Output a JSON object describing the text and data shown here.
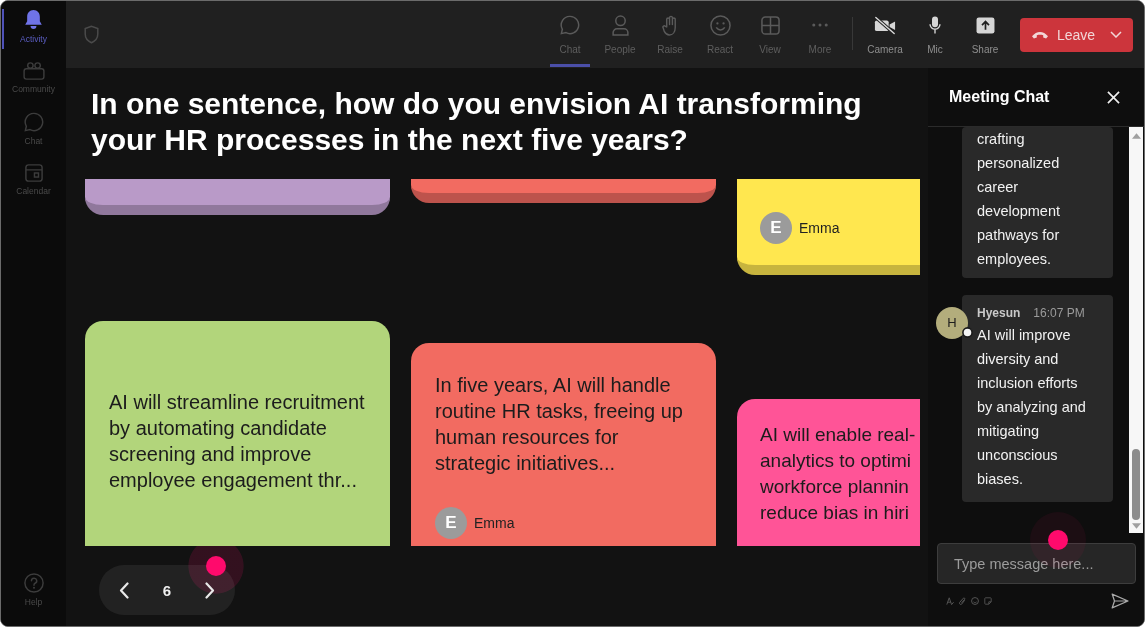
{
  "sidebar": {
    "items": [
      {
        "label": "Activity",
        "selected": true
      },
      {
        "label": "Community",
        "selected": false
      },
      {
        "label": "Chat",
        "selected": false
      },
      {
        "label": "Calendar",
        "selected": false
      }
    ],
    "help": {
      "label": "Help"
    }
  },
  "toolbar": {
    "view_controls": [
      {
        "label": "Chat",
        "selected": true
      },
      {
        "label": "People",
        "selected": false
      },
      {
        "label": "Raise",
        "selected": false
      },
      {
        "label": "React",
        "selected": false
      },
      {
        "label": "View",
        "selected": false
      },
      {
        "label": "More",
        "selected": false
      }
    ],
    "media_controls": [
      {
        "label": "Camera",
        "off": true
      },
      {
        "label": "Mic",
        "off": false
      }
    ],
    "share": {
      "label": "Share"
    },
    "leave": {
      "label": "Leave"
    }
  },
  "board": {
    "question": "In one sentence, how do you envision AI transforming your HR processes in the next five years?",
    "columns": [
      {
        "notes": [
          {
            "color": "#b99ac8"
          },
          {
            "color": "#b2d57b",
            "text": "AI will streamline recruitment by automating candidate screening and improve employee engagement thr..."
          }
        ]
      },
      {
        "notes": [
          {
            "color": "#f26b61"
          },
          {
            "color": "#f26b61",
            "text": "In five years, AI will handle routine HR tasks, freeing up human resources for strategic initiatives...",
            "author": "Emma",
            "initial": "E"
          }
        ]
      },
      {
        "notes": [
          {
            "color": "#ffe74f",
            "author": "Emma",
            "initial": "E"
          },
          {
            "color": "#ff5497",
            "text": "AI will enable real-\nanalytics to optimi\nworkforce plannin\nreduce bias in hiri"
          }
        ]
      }
    ]
  },
  "pagination": {
    "page": "6"
  },
  "chat": {
    "title": "Meeting Chat",
    "messages": [
      {
        "text": "crafting personalized career development pathways for employees."
      },
      {
        "author": "Hyesun",
        "initial": "H",
        "time": "16:07 PM",
        "text": "AI will improve diversity and inclusion efforts by analyzing and mitigating unconscious biases."
      }
    ],
    "input": {
      "placeholder": "Type message here..."
    }
  }
}
